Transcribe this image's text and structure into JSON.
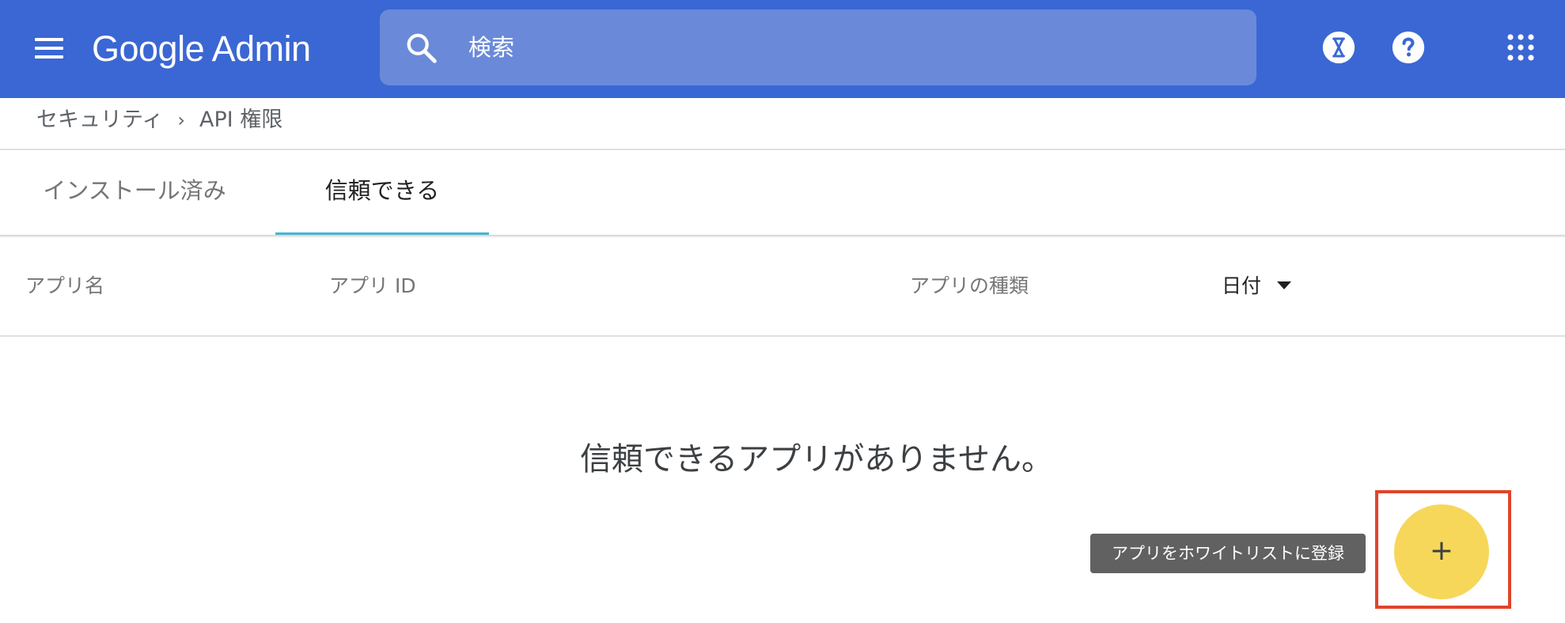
{
  "header": {
    "brand": "Google Admin",
    "search": {
      "placeholder": "検索"
    },
    "icons": [
      "menu-icon",
      "search-icon",
      "hourglass-icon",
      "help-icon",
      "apps-grid-icon"
    ]
  },
  "breadcrumb": {
    "parent": "セキュリティ",
    "separator": "›",
    "current": "API 権限"
  },
  "tabs": [
    {
      "label": "インストール済み",
      "selected": false
    },
    {
      "label": "信頼できる",
      "selected": true
    }
  ],
  "table": {
    "columns": [
      "アプリ名",
      "アプリ ID",
      "アプリの種類",
      "日付"
    ],
    "sort_column": "日付",
    "sort_direction": "descending"
  },
  "empty_state": {
    "message": "信頼できるアプリがありません。"
  },
  "fab": {
    "tooltip": "アプリをホワイトリストに登録",
    "symbol": "+"
  },
  "colors": {
    "topbar": "#3b67d4",
    "search_bg": "#6a8ad9",
    "tab_indicator": "#45b7d3",
    "fab": "#f6d75a",
    "highlight": "#e0442b",
    "tooltip_bg": "#616161"
  }
}
